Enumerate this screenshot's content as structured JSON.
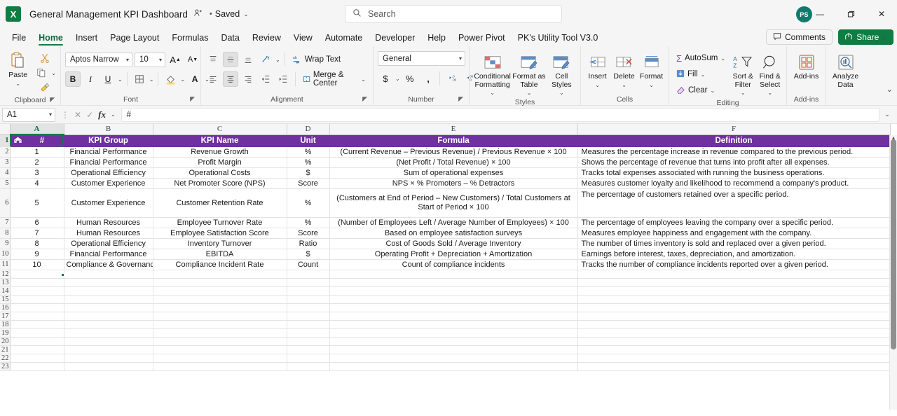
{
  "titlebar": {
    "logo": "X",
    "doc_title": "General Management KPI Dashboard",
    "share_status_icon": "person-share-icon",
    "separator": "•",
    "saved_label": "Saved",
    "saved_caret": "⌄",
    "search_icon": "search-icon",
    "search_placeholder": "Search",
    "avatar_initials": "PS",
    "minimize": "—",
    "maximize": "❐",
    "close": "✕"
  },
  "tabs": [
    {
      "label": "File",
      "active": false
    },
    {
      "label": "Home",
      "active": true
    },
    {
      "label": "Insert",
      "active": false
    },
    {
      "label": "Page Layout",
      "active": false
    },
    {
      "label": "Formulas",
      "active": false
    },
    {
      "label": "Data",
      "active": false
    },
    {
      "label": "Review",
      "active": false
    },
    {
      "label": "View",
      "active": false
    },
    {
      "label": "Automate",
      "active": false
    },
    {
      "label": "Developer",
      "active": false
    },
    {
      "label": "Help",
      "active": false
    },
    {
      "label": "Power Pivot",
      "active": false
    },
    {
      "label": "PK's Utility Tool V3.0",
      "active": false
    }
  ],
  "tabbar_right": {
    "comments_label": "Comments",
    "comments_icon": "comment-icon",
    "share_label": "Share",
    "share_icon": "share-icon",
    "share_caret": "⌄"
  },
  "ribbon": {
    "clipboard": {
      "group_label": "Clipboard",
      "paste_label": "Paste",
      "paste_icon": "paste-icon",
      "paste_caret": "⌄",
      "cut_icon": "scissors-icon",
      "copy_icon": "copy-icon",
      "copy_caret": "⌄",
      "format_painter_icon": "format-painter-icon",
      "dialog_launcher": "dialog-launcher-icon"
    },
    "font": {
      "group_label": "Font",
      "font_name": "Aptos Narrow",
      "font_size": "10",
      "grow_font": "A",
      "shrink_font": "A",
      "bold": "B",
      "italic": "I",
      "underline": "U",
      "underline_caret": "⌄",
      "borders_icon": "borders-icon",
      "borders_caret": "⌄",
      "fill_color_icon": "fill-color-icon",
      "fill_caret": "⌄",
      "font_color": "A",
      "font_color_caret": "⌄",
      "dialog_launcher": "dialog-launcher-icon"
    },
    "alignment": {
      "group_label": "Alignment",
      "align_top_icon": "align-top-icon",
      "align_middle_icon": "align-middle-icon",
      "align_bottom_icon": "align-bottom-icon",
      "orientation_icon": "orientation-icon",
      "orientation_caret": "⌄",
      "align_left_icon": "align-left-icon",
      "align_center_icon": "align-center-icon",
      "align_right_icon": "align-right-icon",
      "decrease_indent_icon": "decrease-indent-icon",
      "increase_indent_icon": "increase-indent-icon",
      "wrap_text_label": "Wrap Text",
      "wrap_text_icon": "wrap-text-icon",
      "merge_center_label": "Merge & Center",
      "merge_center_icon": "merge-cells-icon",
      "merge_caret": "⌄",
      "dialog_launcher": "dialog-launcher-icon"
    },
    "number": {
      "group_label": "Number",
      "format_value": "General",
      "currency": "$",
      "currency_caret": "⌄",
      "percent": "%",
      "comma": " ,",
      "increase_decimal_icon": "increase-decimal-icon",
      "decrease_decimal_icon": "decrease-decimal-icon",
      "dialog_launcher": "dialog-launcher-icon"
    },
    "styles": {
      "group_label": "Styles",
      "conditional_formatting": "Conditional Formatting",
      "conditional_formatting_icon": "conditional-formatting-icon",
      "format_as_table": "Format as Table",
      "format_as_table_icon": "format-as-table-icon",
      "cell_styles": "Cell Styles",
      "cell_styles_icon": "cell-styles-icon",
      "caret": "⌄"
    },
    "cells": {
      "group_label": "Cells",
      "insert": "Insert",
      "insert_icon": "insert-cells-icon",
      "delete": "Delete",
      "delete_icon": "delete-cells-icon",
      "format": "Format",
      "format_icon": "format-cells-icon",
      "caret": "⌄"
    },
    "editing": {
      "group_label": "Editing",
      "autosum": "AutoSum",
      "autosum_icon": "sigma-icon",
      "autosum_caret": "⌄",
      "fill": "Fill",
      "fill_icon": "fill-down-icon",
      "fill_caret": "⌄",
      "clear": "Clear",
      "clear_icon": "eraser-icon",
      "clear_caret": "⌄",
      "sort_filter": "Sort & Filter",
      "sort_filter_icon": "sort-filter-icon",
      "find_select": "Find & Select",
      "find_select_icon": "magnifier-icon",
      "caret": "⌄"
    },
    "addins": {
      "group_label": "Add-ins",
      "addins": "Add-ins",
      "addins_icon": "addins-grid-icon"
    },
    "analyze": {
      "analyze_data": "Analyze Data",
      "analyze_icon": "analyze-data-icon"
    },
    "collapse_caret": "⌄"
  },
  "formula_bar": {
    "name_box_value": "A1",
    "name_box_caret": "⌄",
    "more_icon": "more-options-icon",
    "cancel_icon": "✕",
    "confirm_icon": "✓",
    "fx_icon": "fx",
    "fx_caret": "⌄",
    "formula_value": "#",
    "expand_caret": "⌄"
  },
  "grid": {
    "column_headers": [
      "A",
      "B",
      "C",
      "D",
      "E",
      "F"
    ],
    "selected_cell": "A1",
    "header_fill": "#7030A0",
    "header_text_color": "#FFFFFF",
    "row_numbers": [
      1,
      2,
      3,
      4,
      5,
      6,
      7,
      8,
      9,
      10,
      11,
      12,
      13,
      14,
      15,
      16,
      17,
      18,
      19,
      20,
      21,
      22,
      23
    ],
    "header_row": {
      "a_icon": "home-icon",
      "a": "#",
      "b": "KPI Group",
      "c": "KPI Name",
      "d": "Unit",
      "e": "Formula",
      "f": "Definition"
    },
    "rows": [
      {
        "num": "1",
        "group": "Financial Performance",
        "name": "Revenue Growth",
        "unit": "%",
        "formula": "(Current Revenue – Previous Revenue) / Previous Revenue × 100",
        "definition": "Measures the percentage increase in revenue compared to the previous period."
      },
      {
        "num": "2",
        "group": "Financial Performance",
        "name": "Profit Margin",
        "unit": "%",
        "formula": "(Net Profit / Total Revenue) × 100",
        "definition": "Shows the percentage of revenue that turns into profit after all expenses."
      },
      {
        "num": "3",
        "group": "Operational Efficiency",
        "name": "Operational Costs",
        "unit": "$",
        "formula": "Sum of operational expenses",
        "definition": "Tracks total expenses associated with running the business operations."
      },
      {
        "num": "4",
        "group": "Customer Experience",
        "name": "Net Promoter Score (NPS)",
        "unit": "Score",
        "formula": "NPS × % Promoters – % Detractors",
        "definition": "Measures customer loyalty and likelihood to recommend a company's product."
      },
      {
        "num": "5",
        "group": "Customer Experience",
        "name": "Customer Retention Rate",
        "unit": "%",
        "formula": "(Customers at End of Period – New Customers) / Total Customers at Start of Period × 100",
        "definition": "The percentage of customers retained over a specific period."
      },
      {
        "num": "6",
        "group": "Human Resources",
        "name": "Employee Turnover Rate",
        "unit": "%",
        "formula": "(Number of Employees Left / Average Number of Employees) × 100",
        "definition": "The percentage of employees leaving the company over a specific period."
      },
      {
        "num": "7",
        "group": "Human Resources",
        "name": "Employee Satisfaction Score",
        "unit": "Score",
        "formula": "Based on employee satisfaction surveys",
        "definition": "Measures employee happiness and engagement with the company."
      },
      {
        "num": "8",
        "group": "Operational Efficiency",
        "name": "Inventory Turnover",
        "unit": "Ratio",
        "formula": "Cost of Goods Sold / Average Inventory",
        "definition": "The number of times inventory is sold and replaced over a given period."
      },
      {
        "num": "9",
        "group": "Financial Performance",
        "name": "EBITDA",
        "unit": "$",
        "formula": "Operating Profit + Depreciation + Amortization",
        "definition": "Earnings before interest, taxes, depreciation, and amortization."
      },
      {
        "num": "10",
        "group": "Compliance & Governance",
        "name": "Compliance Incident Rate",
        "unit": "Count",
        "formula": "Count of compliance incidents",
        "definition": "Tracks the number of compliance incidents reported over a given period."
      }
    ]
  }
}
